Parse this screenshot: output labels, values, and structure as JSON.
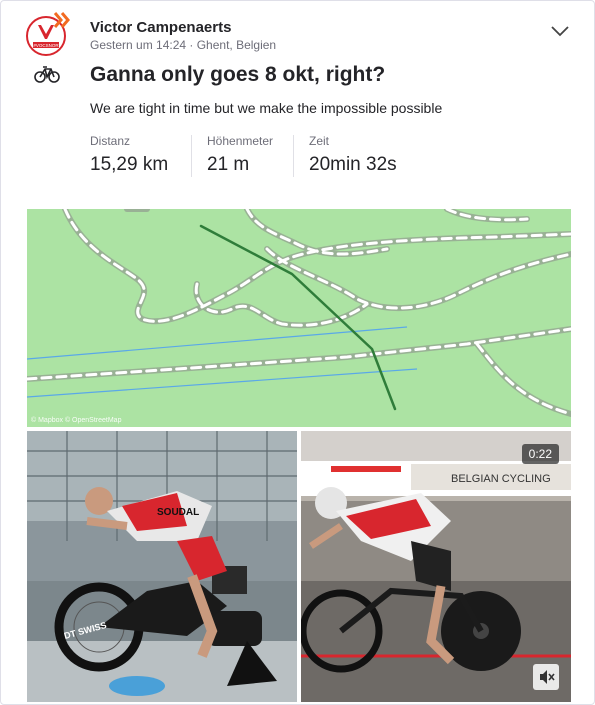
{
  "athlete": {
    "name": "Victor Campenaerts",
    "avatar_text": "#VOCSNOR",
    "meta": "Gestern um 14:24 · Ghent, Belgien"
  },
  "activity": {
    "sport_icon": "bike-icon",
    "title": "Ganna only goes 8 okt, right?",
    "description": "We are tight in time but we make the impossible possible"
  },
  "stats": [
    {
      "label": "Distanz",
      "value": "15,29 km"
    },
    {
      "label": "Höhenmeter",
      "value": "21 m"
    },
    {
      "label": "Zeit",
      "value": "20min 32s"
    }
  ],
  "map": {
    "attribution": "© Mapbox © OpenStreetMap",
    "route_color": "#2f7d3a",
    "land_color": "#ace3a3"
  },
  "media": {
    "video_duration": "0:22",
    "banner_text": "BELGIAN CYCLING",
    "jersey_text": "SOUDAL",
    "wheel_text": "DT SWISS"
  },
  "colors": {
    "brand": "#d8262e",
    "accent": "#fc5200"
  }
}
